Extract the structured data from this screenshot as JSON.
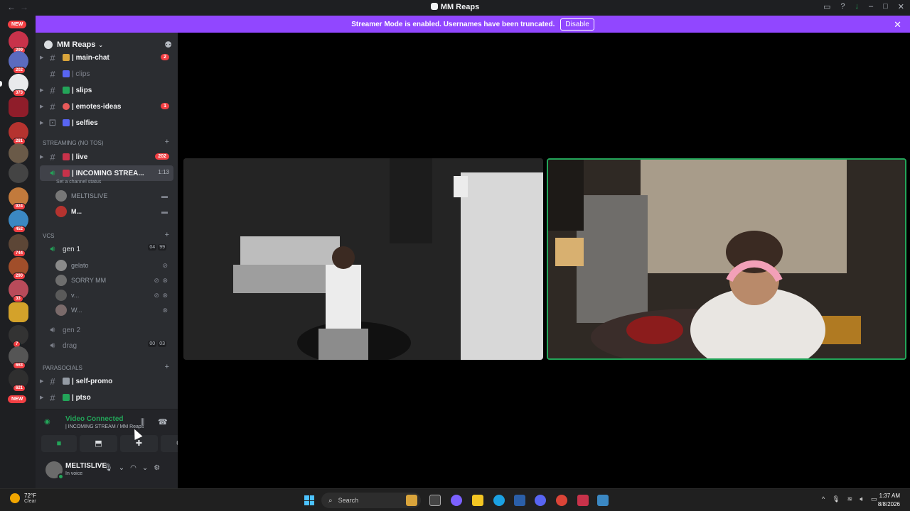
{
  "window": {
    "title": "MM Reaps"
  },
  "banner": {
    "text": "Streamer Mode is enabled. Usernames have been truncated.",
    "button": "Disable"
  },
  "rail": {
    "new_top": "NEW",
    "new_bottom": "NEW",
    "badges": [
      "299",
      "202",
      "373",
      "281",
      "924",
      "452",
      "744",
      "290",
      "33",
      "7",
      "663",
      "621"
    ]
  },
  "server": {
    "name": "MM Reaps"
  },
  "channels_top": [
    {
      "name": "| main-chat",
      "badge": "2"
    },
    {
      "name": "| clips"
    },
    {
      "name": "| slips"
    },
    {
      "name": "| emotes-ideas",
      "badge": "1"
    },
    {
      "name": "| selfies"
    }
  ],
  "cat_streaming": "STREAMING (NO TOS)",
  "streaming": {
    "live": {
      "name": "| live",
      "badge": "202"
    },
    "incoming": {
      "name": "| INCOMING STREA...",
      "timer": "1:13",
      "status": "Set a channel status"
    },
    "users": [
      "MELTISLIVE",
      "M..."
    ]
  },
  "cat_vcs": "VCs",
  "gen1": {
    "name": "gen 1",
    "count_a": "04",
    "count_b": "99"
  },
  "gen1_users": [
    "gelato",
    "SORRY MM",
    "v...",
    "W..."
  ],
  "gen2": {
    "name": "gen 2"
  },
  "drag": {
    "name": "drag",
    "count_a": "00",
    "count_b": "03"
  },
  "cat_para": "PARASOCIALS",
  "para": [
    {
      "name": "| self-promo"
    },
    {
      "name": "| ptso"
    }
  ],
  "voice": {
    "title": "Video Connected",
    "sub": "| INCOMING STREAM / MM Reaps"
  },
  "user": {
    "name": "MELTISLIVE",
    "status": "In voice"
  },
  "taskbar": {
    "temp": "72°F",
    "cond": "Clear",
    "search": "Search",
    "time": "1:37 AM",
    "date": "8/8/2026"
  },
  "colors": {
    "accent": "#9147ff",
    "online": "#23a559",
    "mention": "#f23f43"
  }
}
